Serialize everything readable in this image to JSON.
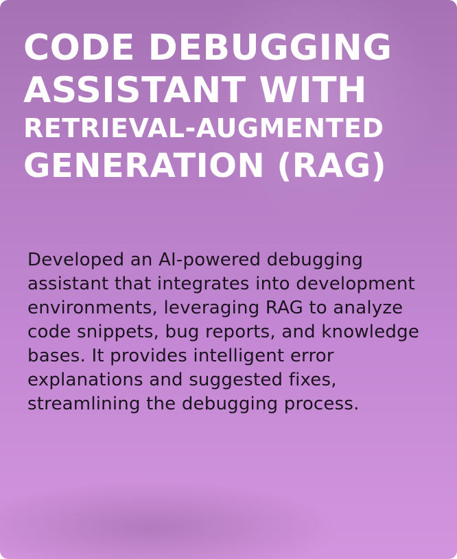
{
  "card": {
    "title_lines": [
      "CODE DEBUGGING",
      "ASSISTANT WITH",
      "RETRIEVAL-AUGMENTED",
      "GENERATION (RAG)"
    ],
    "description": "Developed an AI-powered debugging assistant that integrates into development environments, leveraging RAG to analyze code snippets, bug reports, and knowledge bases. It provides intelligent error explanations and suggested fixes, streamlining the debugging process."
  },
  "colors": {
    "background_top": "#a672b4",
    "background_bottom": "#d394de",
    "title_text": "#ffffff",
    "body_text": "#1c1320"
  }
}
